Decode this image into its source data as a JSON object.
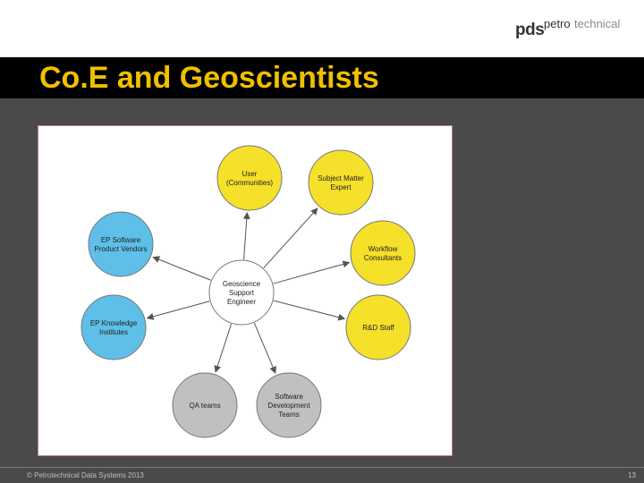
{
  "slide": {
    "title": "Co.E and Geoscientists",
    "copyright": "© Petrotechnical Data Systems 2013",
    "page_number": "13"
  },
  "logo": {
    "pds": "pds",
    "petro": "petro",
    "technical": "technical"
  },
  "diagram": {
    "center": {
      "lines": [
        "Geoscience",
        "Support",
        "Engineer"
      ],
      "color": "#ffffff"
    },
    "nodes": [
      {
        "key": "user",
        "lines": [
          "User",
          "(Communities)"
        ],
        "color": "#f5e02a"
      },
      {
        "key": "sme",
        "lines": [
          "Subject Matter",
          "Expert"
        ],
        "color": "#f5e02a"
      },
      {
        "key": "workflow",
        "lines": [
          "Workflow",
          "Consultants"
        ],
        "color": "#f5e02a"
      },
      {
        "key": "rd",
        "lines": [
          "R&D Staff"
        ],
        "color": "#f5e02a"
      },
      {
        "key": "swdev",
        "lines": [
          "Software",
          "Development",
          "Teams"
        ],
        "color": "#c0c0c0"
      },
      {
        "key": "qa",
        "lines": [
          "QA teams"
        ],
        "color": "#c0c0c0"
      },
      {
        "key": "epki",
        "lines": [
          "EP Knowledge",
          "Institutes"
        ],
        "color": "#5ebfe8"
      },
      {
        "key": "epsw",
        "lines": [
          "EP Software",
          "Product Vendors"
        ],
        "color": "#5ebfe8"
      }
    ]
  }
}
